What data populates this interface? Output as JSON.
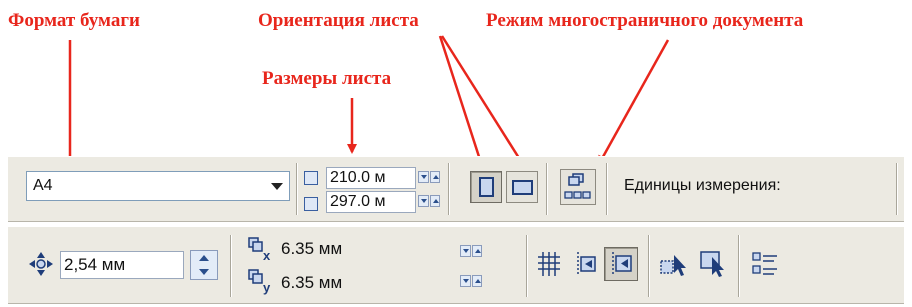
{
  "annotations": {
    "paper_format": "Формат бумаги",
    "sheet_orientation": "Ориентация листа",
    "multipage_mode": "Режим многостраничного документа",
    "sheet_size": "Размеры листа"
  },
  "property_bar": {
    "paper_format": {
      "value": "A4"
    },
    "width": {
      "value": "210.0 м"
    },
    "height": {
      "value": "297.0 м"
    },
    "units_label": "Единицы измерения:"
  },
  "nudge_bar": {
    "nudge": {
      "value": "2,54 мм"
    },
    "duplicate_x": {
      "axis": "x",
      "value": "6.35 мм"
    },
    "duplicate_y": {
      "axis": "y",
      "value": "6.35 мм"
    }
  },
  "icons": [
    "width-icon",
    "height-icon",
    "portrait-icon",
    "landscape-icon",
    "multipage-icon",
    "nudge-icon",
    "snap-to-grid-icon",
    "snap-to-guidelines-icon",
    "snap-to-objects-icon",
    "pick-tool-icon",
    "select-inside-icon",
    "options-list-icon"
  ],
  "colors": {
    "annotation": "#e8261c",
    "toolbar": "#eceae2",
    "icon_blue": "#1f3d7a"
  }
}
